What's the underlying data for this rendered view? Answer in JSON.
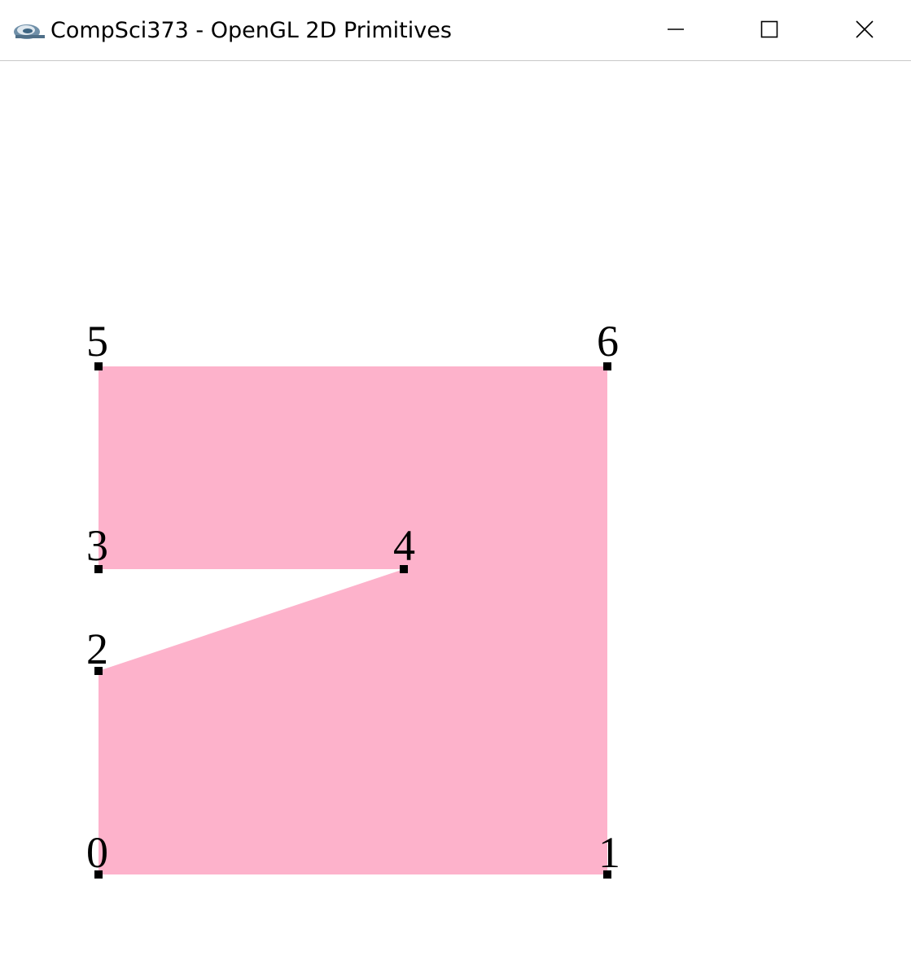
{
  "window": {
    "title": "CompSci373 - OpenGL 2D Primitives",
    "app_icon": "app-logo-icon",
    "controls": {
      "minimize": "minimize-icon",
      "maximize": "maximize-icon",
      "close": "close-icon"
    }
  },
  "canvas": {
    "fill_color": "#fdb2cb",
    "vertex_color": "#000000",
    "vertices": [
      {
        "label": "0"
      },
      {
        "label": "1"
      },
      {
        "label": "2"
      },
      {
        "label": "3"
      },
      {
        "label": "4"
      },
      {
        "label": "5"
      },
      {
        "label": "6"
      }
    ]
  }
}
